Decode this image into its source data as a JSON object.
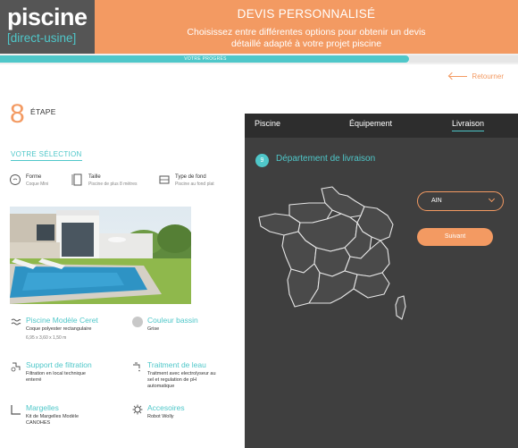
{
  "header": {
    "logo_main": "piscine",
    "logo_sub": "[direct-usine]",
    "title": "DEVIS PERSONNALISÉ",
    "subtitle_line1": "Choisissez entre différentes options pour obtenir un devis",
    "subtitle_line2": "détaillé adapté à votre projet piscine"
  },
  "progress": {
    "label": "VOTRE PROGRÈS",
    "value_percent": 79
  },
  "back_label": "Retourner",
  "step": {
    "number": "8",
    "label": "ÉTAPE"
  },
  "selection": {
    "title": "VOTRE SÉLECTION",
    "specs": [
      {
        "label": "Forme",
        "value": "Coque Mini",
        "icon": "pool-shape-icon"
      },
      {
        "label": "Taille",
        "value": "Piscine de plus 8 mètres",
        "icon": "size-icon"
      },
      {
        "label": "Type de fond",
        "value": "Piscine au fond plat",
        "icon": "pool-floor-icon"
      }
    ]
  },
  "options": {
    "model": {
      "title": "Piscine Modèle Ceret",
      "desc": "Coque polyester rectangulaire",
      "extra": "6,95 x 3,60 x 1,50 m"
    },
    "color": {
      "title": "Couleur bassin",
      "desc": "Grise",
      "swatch": "#c8c8c8"
    },
    "filtration": {
      "title": "Support de filtration",
      "desc_line1": "Filtration en local technique",
      "desc_line2": "enterré"
    },
    "treatment": {
      "title": "Traitment de leau",
      "desc_line1": "Traitment avec electrolyseur au",
      "desc_line2": "sel et regulation de pH",
      "desc_line3": "automatique"
    },
    "margelles": {
      "title": "Margelles",
      "desc_line1": "Kit de Margelles Modèle",
      "desc_line2": "CANOHES"
    },
    "accessories": {
      "title": "Accesoires",
      "desc": "Robot Wolly"
    }
  },
  "panel": {
    "tabs": [
      "Piscine",
      "Équipement",
      "Livraison"
    ],
    "active_tab": "Livraison",
    "section_number": "9",
    "section_title": "Département de livraison",
    "select_value": "AIN",
    "next_label": "Suivant"
  },
  "colors": {
    "accent": "#f39a62",
    "teal": "#4fc7c9",
    "logo_bg": "#555555",
    "panel_bg": "#3f3f3f"
  }
}
